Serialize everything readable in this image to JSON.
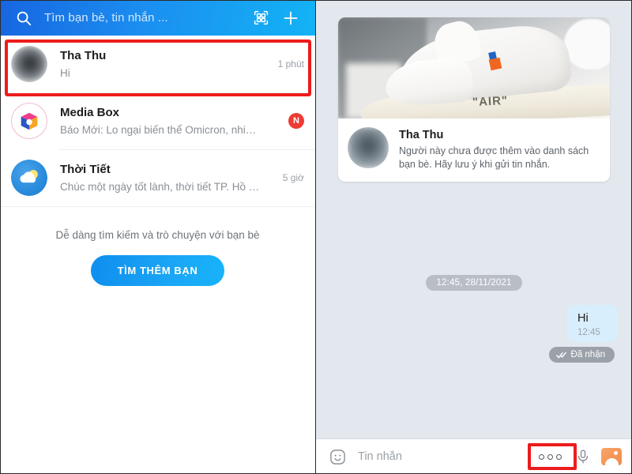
{
  "left_panel": {
    "search": {
      "placeholder": "Tìm bạn bè, tin nhắn ...",
      "search_icon": "search-icon",
      "qr_icon": "qr-code-icon",
      "add_icon": "plus-icon"
    },
    "chats": [
      {
        "name": "Tha Thu",
        "snippet": "Hi",
        "time": "1 phút",
        "badge": "",
        "avatar": "blurred-photo-avatar",
        "highlighted": true
      },
      {
        "name": "Media Box",
        "snippet": "Báo Mới: Lo ngại biến thể Omicron, nhiều...",
        "time": "",
        "badge": "N",
        "avatar": "media-box-cube-icon",
        "highlighted": false
      },
      {
        "name": "Thời Tiết",
        "snippet": "Chúc một ngày tốt lành, thời tiết TP. Hồ Chí...",
        "time": "5 giờ",
        "badge": "",
        "avatar": "weather-cloud-sun-icon",
        "highlighted": false
      }
    ],
    "promo": {
      "text": "Dễ dàng tìm kiếm và trò chuyện với bạn bè",
      "button_label": "TÌM THÊM BẠN"
    }
  },
  "right_panel": {
    "contact_card": {
      "photo_caption": "\"AIR\"",
      "name": "Tha Thu",
      "note": "Người này chưa được thêm vào danh sách bạn bè. Hãy lưu ý khi gửi tin nhắn."
    },
    "day_divider": "12:45, 28/11/2021",
    "messages": [
      {
        "text": "Hi",
        "time": "12:45",
        "direction": "outgoing"
      }
    ],
    "delivery_status": "Đã nhận",
    "delivery_check_icon": "double-check-icon",
    "composer": {
      "emoji_icon": "smiley-face-icon",
      "placeholder": "Tin nhắn",
      "value": "",
      "more_icon": "three-dots-more-icon",
      "mic_icon": "microphone-icon",
      "gallery_icon": "image-gallery-icon"
    }
  },
  "annotations": {
    "highlight_color": "#ec1c1c",
    "boxes": [
      {
        "name": "chat-row-tha-thu-highlight"
      },
      {
        "name": "more-options-highlight"
      }
    ]
  },
  "colors": {
    "header_blue_start": "#1766e0",
    "header_blue_end": "#13b3f5",
    "accent_blue": "#1aa6f5",
    "badge_red": "#ee3b33",
    "chat_bg": "#e3e8ee",
    "bubble_out": "#d9eefc"
  }
}
